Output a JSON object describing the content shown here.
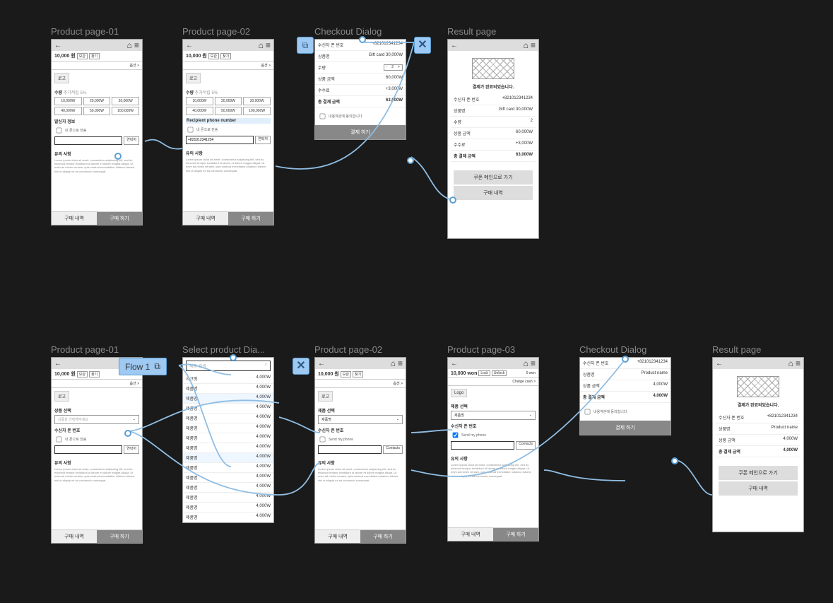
{
  "flow_badge": "Flow 1",
  "common": {
    "send_my_phone_kr": "내 폰으로 전송",
    "send_my_phone_en": "Send my phone",
    "contacts_kr": "연락처",
    "contacts_en": "Contacts",
    "notice_title": "유의 사항",
    "notice_text": "Lorem ipsum dolor sit amet, consectetur adipiscing elit, sed do eiusmod tempor incididunt ut labore et dolore magna aliqua. Ut enim ad minim veniam, quis nostrud exercitation ullamco laboris nisi ut aliquip ex ea commodo consequat.",
    "history_btn": "구매 내역",
    "buy_btn": "구매 하기",
    "checkout_btn": "결제 하기",
    "coupon_main_btn": "쿠폰 메인으로 가기",
    "option_label": "옵션 >",
    "lock": "보관",
    "unlock": "찾기",
    "lock_en": "Lock",
    "unlock_en": "Unlock",
    "charge_cash": "Charge cash >",
    "discount_note": "추가적립 5%"
  },
  "row1": {
    "frames": {
      "p1": "Product page-01",
      "p2": "Product page-02",
      "checkout": "Checkout Dialog",
      "result": "Result page"
    },
    "price": "10,000 원",
    "logo": "로고",
    "qty_label": "수량",
    "amounts": [
      "10,000W",
      "20,000W",
      "30,000W",
      "40,000W",
      "50,000W",
      "100,000W"
    ],
    "sender_info": "발신자 정보",
    "recipient_phone": "Recipient phone number",
    "recipient_value": "+821012341234",
    "checkout": {
      "recipient_label": "수신자 폰 번호",
      "recipient_value": "+821012341234",
      "product_label": "상품명",
      "product_value": "Gift card 30,000W",
      "qty_label": "수량",
      "qty_value": "2",
      "subtotal_label": "상품 금액",
      "subtotal_value": "60,000W",
      "fee_label": "수수료",
      "fee_value": "+3,000W",
      "total_label": "총 결제 금액",
      "total_value": "63,000W",
      "terms": "내용약관에 동의합니다"
    },
    "result": {
      "msg": "결제가 완료되었습니다."
    }
  },
  "row2": {
    "frames": {
      "p1": "Product page-01",
      "select": "Select product Dia...",
      "p2": "Product page-02",
      "p3": "Product page-03",
      "checkout": "Checkout Dialog",
      "result": "Result page"
    },
    "p1": {
      "price": "10,000 원",
      "select_label": "상품 선택",
      "select_placeholder": "상품을 선택해주세요",
      "recipient_label": "수신자 폰 번호"
    },
    "select": {
      "search_placeholder": "제품 검색",
      "items": [
        {
          "name": "시크릿",
          "price": "4,000W"
        },
        {
          "name": "제품명",
          "price": "4,000W"
        },
        {
          "name": "제품명",
          "price": "4,000W"
        },
        {
          "name": "제품명",
          "price": "4,000W"
        },
        {
          "name": "제품명",
          "price": "4,000W"
        },
        {
          "name": "제품명",
          "price": "4,000W"
        },
        {
          "name": "제품명",
          "price": "4,000W"
        },
        {
          "name": "제품명",
          "price": "4,000W"
        },
        {
          "name": "제품명",
          "price": "4,000W"
        },
        {
          "name": "제품명",
          "price": "4,000W"
        },
        {
          "name": "제품명",
          "price": "4,000W"
        },
        {
          "name": "제품명",
          "price": "4,000W"
        },
        {
          "name": "제품명",
          "price": "4,000W"
        },
        {
          "name": "제품명",
          "price": "4,000W"
        },
        {
          "name": "제품명",
          "price": "4,000W"
        }
      ]
    },
    "p2": {
      "price": "10,000 원",
      "logo": "로고",
      "select_label": "제품 선택",
      "select_value": "제품명",
      "recipient_label": "수신자 폰 번호"
    },
    "p3": {
      "price": "10,000 won",
      "balance": "0 won",
      "logo": "Logo",
      "select_label": "제품 선택",
      "select_value": "제품명",
      "recipient_label": "수신자 폰 번호"
    },
    "checkout": {
      "recipient_label": "수신자 폰 번호",
      "recipient_value": "+821012341234",
      "product_label": "상품명",
      "product_value": "Product name",
      "subtotal_label": "상품 금액",
      "subtotal_value": "4,000W",
      "total_label": "총 결제 금액",
      "total_value": "4,000W",
      "terms": "내용약관에 동의합니다"
    },
    "result": {
      "msg": "결제가 완료되었습니다.",
      "product_value": "Product name",
      "subtotal_value": "4,000W",
      "total_value": "4,000W"
    }
  }
}
